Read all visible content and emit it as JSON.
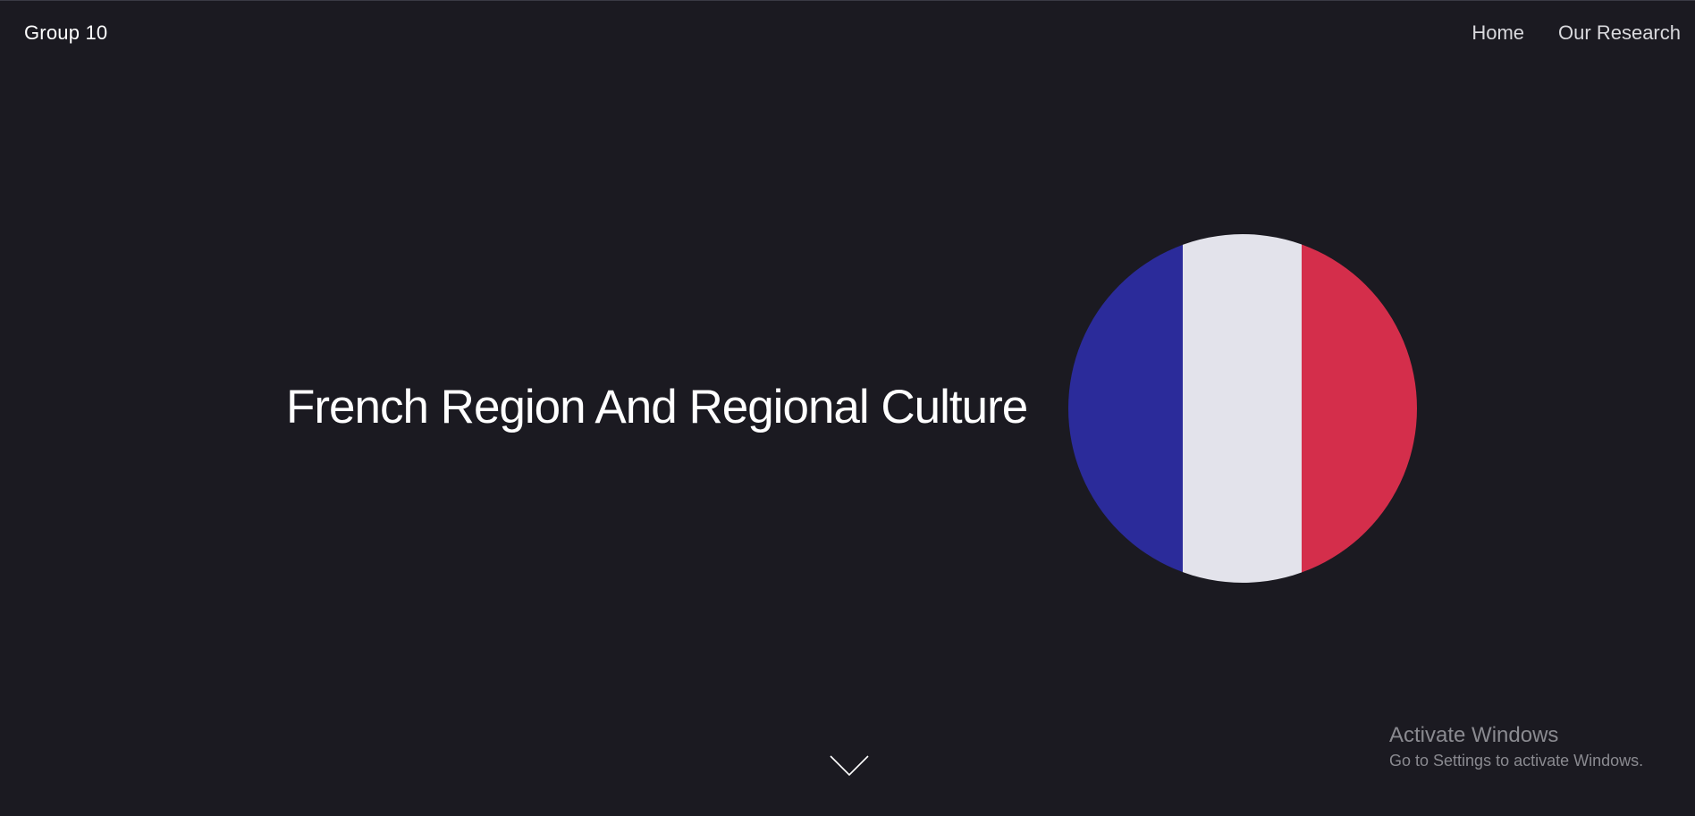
{
  "header": {
    "brand": "Group 10",
    "nav": [
      {
        "label": "Home"
      },
      {
        "label": "Our Research"
      }
    ]
  },
  "hero": {
    "title": "French Region And Regional Culture",
    "image": {
      "name": "french-flag-circle",
      "stripes": [
        "#2b2b9a",
        "#e3e3eb",
        "#d42e4b"
      ]
    },
    "scroll_icon": "chevron-down-icon"
  },
  "watermark": {
    "title": "Activate Windows",
    "subtitle": "Go to Settings to activate Windows."
  },
  "colors": {
    "background": "#1b1a21",
    "text": "#ffffff",
    "nav_text": "#d9d9dd",
    "watermark_text": "#8a8a90"
  }
}
